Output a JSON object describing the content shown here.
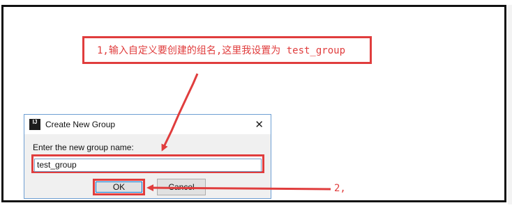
{
  "callout": {
    "text": "1,输入自定义要创建的组名,这里我设置为 test_group"
  },
  "dialog": {
    "app_icon": "IJ",
    "title": "Create New Group",
    "close_icon": "close-icon",
    "label": "Enter the new group name:",
    "input_value": "test_group",
    "ok_label": "OK",
    "cancel_label": "Cancel"
  },
  "annotation2": {
    "text": "2,"
  },
  "colors": {
    "annotation_red": "#e03d3d",
    "dialog_border": "#6d9fd3"
  }
}
